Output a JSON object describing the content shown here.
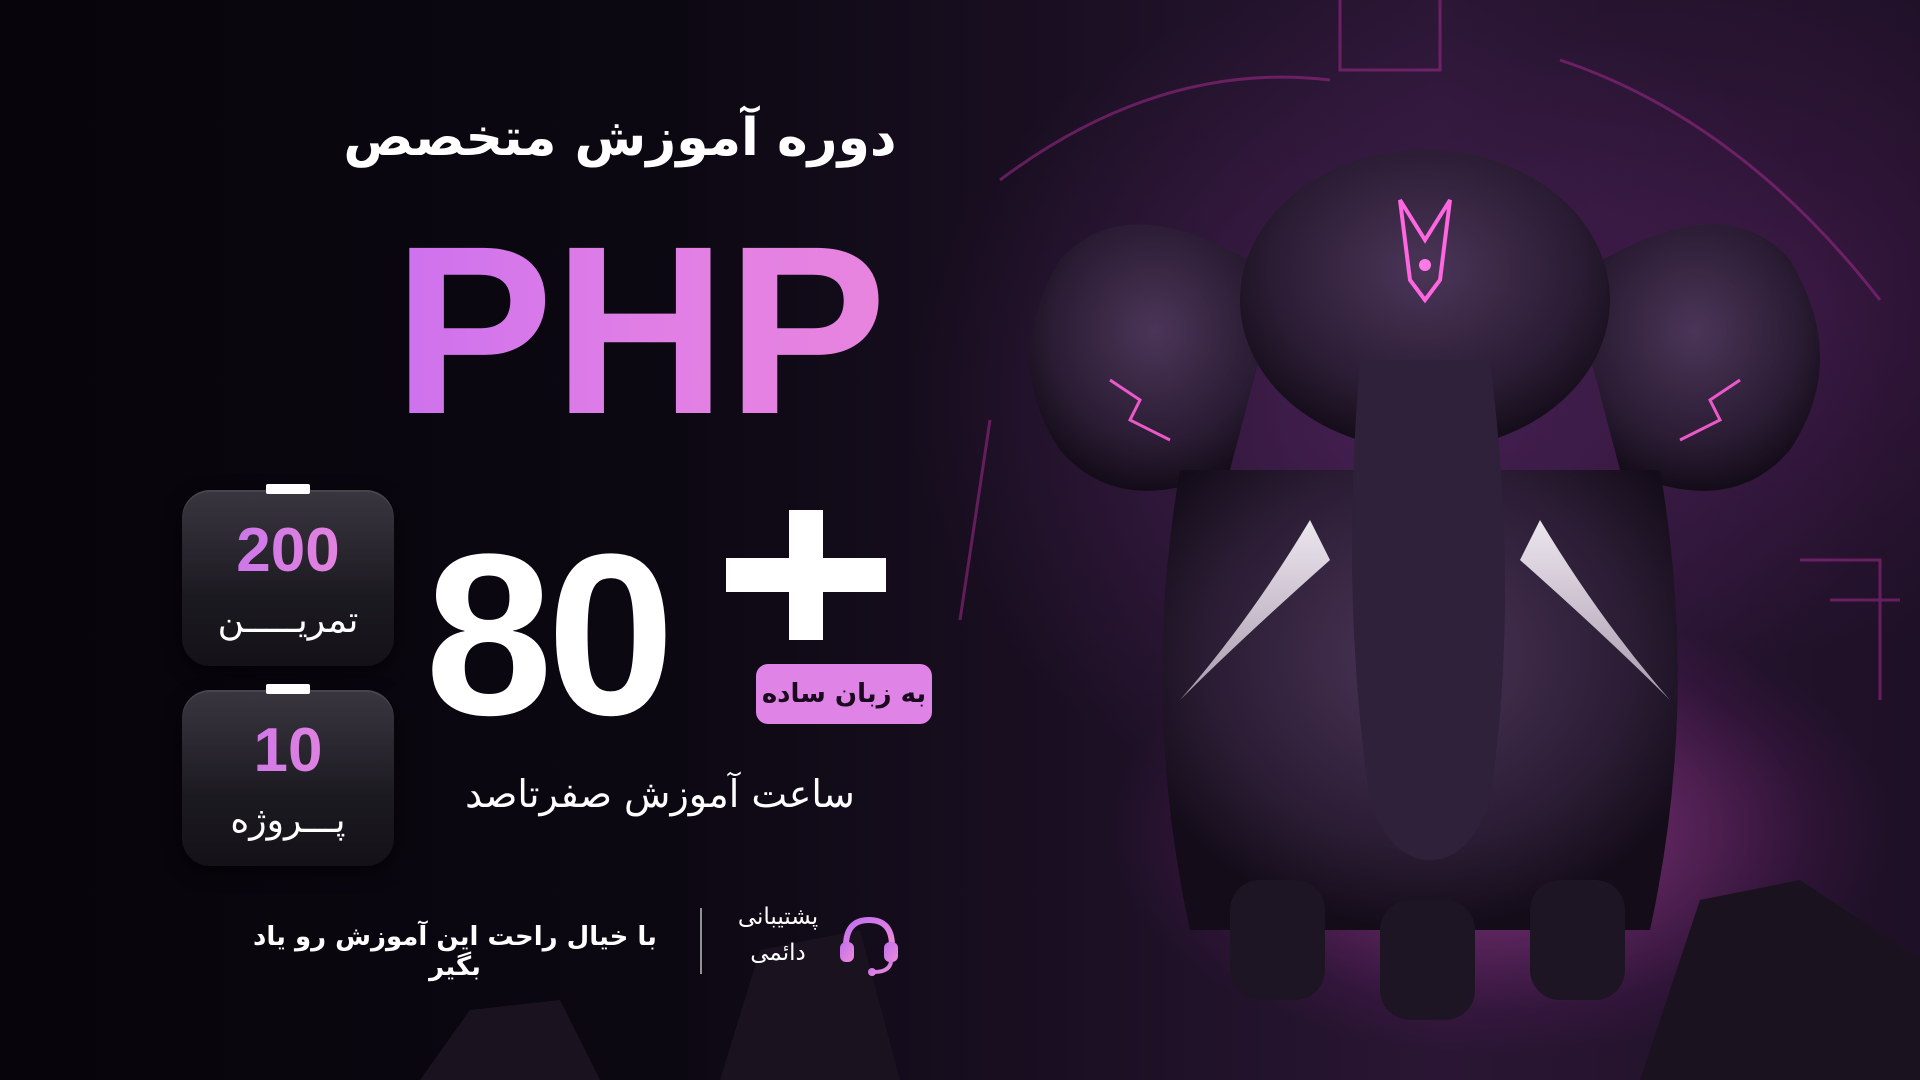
{
  "headline": {
    "course_title": "دوره آموزش متخصص",
    "main_word": "PHP"
  },
  "stats": [
    {
      "value": "200",
      "label": "تمریـــــن"
    },
    {
      "value": "10",
      "label": "پـــروژه"
    }
  ],
  "hours": {
    "value": "80",
    "tag": "به زبان ساده",
    "caption": "ساعت آموزش صفرتاصد"
  },
  "footer": {
    "tagline": "با خیال راحت این آموزش رو یاد بگیر",
    "support_line_1": "پشتیبانی",
    "support_line_2": "دائمی"
  },
  "colors": {
    "accent": "#e083e6",
    "gradient_start": "#c86ef0",
    "gradient_end": "#ea86dc",
    "background": "#0a0610"
  },
  "icons": {
    "support": "headset-icon"
  }
}
